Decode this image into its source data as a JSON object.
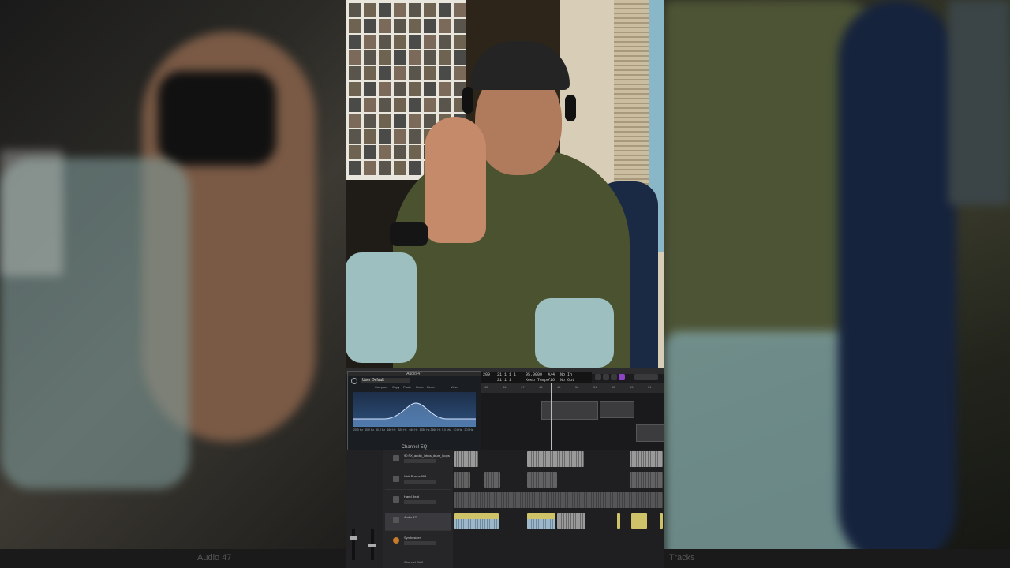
{
  "daw": {
    "window_title": "Audio 47",
    "plugin": {
      "title": "Audio 47",
      "preset": "User Default",
      "tabs": [
        "Compare",
        "Copy",
        "Paste",
        "Undo",
        "Redo"
      ],
      "view_label": "View",
      "name": "Channel EQ",
      "band_values": [
        "20.0 Hz",
        "40.0 Hz",
        "80.0 Hz",
        "160 Hz",
        "320 Hz",
        "640 Hz",
        "1280 Hz",
        "2560 Hz",
        "5.0 kHz",
        "10 kHz",
        "20 kHz"
      ]
    },
    "lcd": {
      "position": "21 1 1 1",
      "tempo": "95.0000",
      "time_signature": "4/4",
      "key": "No In",
      "division": "/16",
      "tempo_label": "Keep Tempo",
      "out": "No Out",
      "bar": "209",
      "bar2": "21 1 1"
    },
    "ruler_ticks": [
      "45",
      "46",
      "47",
      "48",
      "49",
      "50",
      "51",
      "52",
      "53",
      "54"
    ],
    "tracks": [
      {
        "name": "90 FX_audio_intros_drum_loops"
      },
      {
        "name": "Kick Drums 806"
      },
      {
        "name": "Hand Beat"
      },
      {
        "name": "Audio 47"
      },
      {
        "name": "Synthesizer"
      }
    ],
    "bottom_label": "Channel Stuff"
  },
  "side_left": {
    "bottom_text": "Audio 47"
  },
  "side_right": {
    "bottom_text": "Tracks"
  }
}
